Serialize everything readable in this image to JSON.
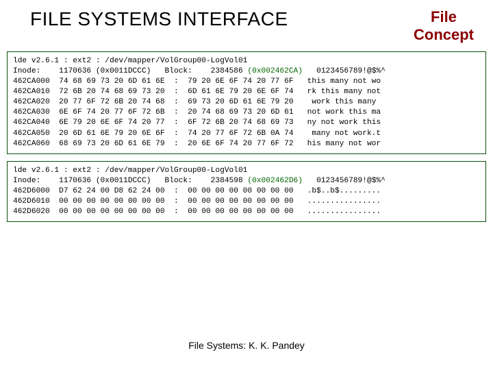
{
  "header": {
    "main_title": "FILE SYSTEMS INTERFACE",
    "side_title_line1": "File",
    "side_title_line2": "Concept"
  },
  "dump1": {
    "line1_a": "lde v2.6.1 : ext2 : /dev/mapper/VolGroup00-LogVol01",
    "line2_a": "Inode:    1170636 (0x0011DCCC)   Block:    2384586 ",
    "line2_hl": "(0x002462CA)",
    "line2_tail": "   0123456789!@$%^",
    "rows": [
      "462CA000  74 68 69 73 20 6D 61 6E  :  79 20 6E 6F 74 20 77 6F   this many not wo",
      "462CA010  72 6B 20 74 68 69 73 20  :  6D 61 6E 79 20 6E 6F 74   rk this many not",
      "462CA020  20 77 6F 72 6B 20 74 68  :  69 73 20 6D 61 6E 79 20    work this many ",
      "462CA030  6E 6F 74 20 77 6F 72 6B  :  20 74 68 69 73 20 6D 61   not work this ma",
      "462CA040  6E 79 20 6E 6F 74 20 77  :  6F 72 6B 20 74 68 69 73   ny not work this",
      "462CA050  20 6D 61 6E 79 20 6E 6F  :  74 20 77 6F 72 6B 0A 74    many not work.t",
      "462CA060  68 69 73 20 6D 61 6E 79  :  20 6E 6F 74 20 77 6F 72   his many not wor"
    ]
  },
  "dump2": {
    "line1_a": "lde v2.6.1 : ext2 : /dev/mapper/VolGroup00-LogVol01",
    "line2_a": "Inode:    1170636 (0x0011DCCC)   Block:    2384598 ",
    "line2_hl": "(0x002462D6)",
    "line2_tail": "   0123456789!@$%^",
    "rows": [
      "462D6000  D7 62 24 00 D8 62 24 00  :  00 00 00 00 00 00 00 00   .b$..b$.........",
      "462D6010  00 00 00 00 00 00 00 00  :  00 00 00 00 00 00 00 00   ................",
      "462D6020  00 00 00 00 00 00 00 00  :  00 00 00 00 00 00 00 00   ................"
    ]
  },
  "footer": "File Systems: K. K. Pandey"
}
